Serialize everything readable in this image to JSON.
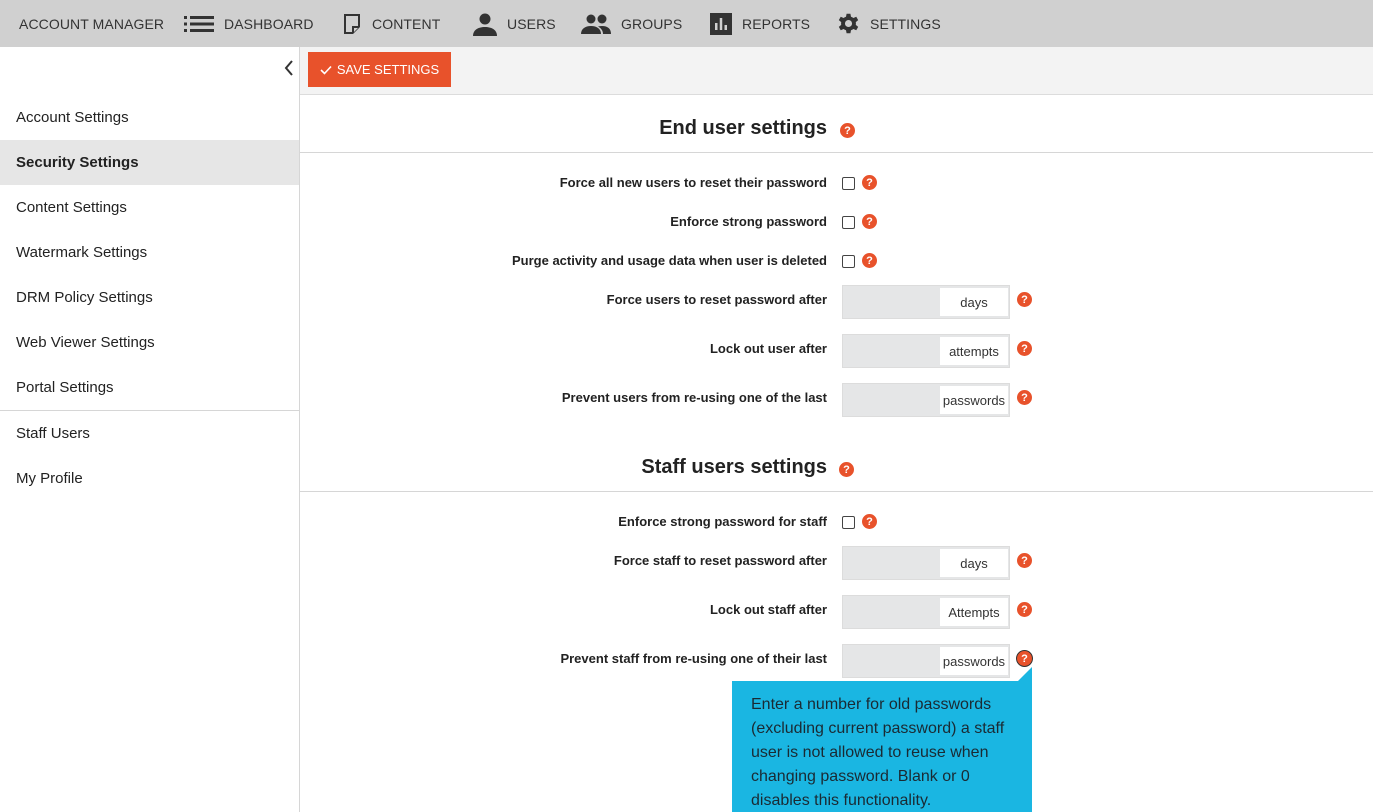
{
  "nav": {
    "brand": "ACCOUNT MANAGER",
    "items": [
      {
        "label": "DASHBOARD",
        "icon": "list-icon"
      },
      {
        "label": "CONTENT",
        "icon": "document-icon"
      },
      {
        "label": "USERS",
        "icon": "user-icon"
      },
      {
        "label": "GROUPS",
        "icon": "group-icon"
      },
      {
        "label": "REPORTS",
        "icon": "bar-chart-icon"
      },
      {
        "label": "SETTINGS",
        "icon": "gear-icon"
      }
    ]
  },
  "sidebar": {
    "items": [
      {
        "label": "Account Settings"
      },
      {
        "label": "Security Settings",
        "active": true
      },
      {
        "label": "Content Settings"
      },
      {
        "label": "Watermark Settings"
      },
      {
        "label": "DRM Policy Settings"
      },
      {
        "label": "Web Viewer Settings"
      },
      {
        "label": "Portal Settings"
      },
      {
        "label": "Staff Users"
      },
      {
        "label": "My Profile"
      }
    ]
  },
  "toolbar": {
    "save_label": "SAVE SETTINGS"
  },
  "end_user": {
    "title": "End user settings",
    "rows": [
      {
        "label": "Force all new users to reset their password",
        "type": "checkbox",
        "checked": false
      },
      {
        "label": "Enforce strong password",
        "type": "checkbox",
        "checked": false
      },
      {
        "label": "Purge activity and usage data when user is deleted",
        "type": "checkbox",
        "checked": false
      },
      {
        "label": "Force users to reset password after",
        "type": "number",
        "value": "",
        "unit": "days"
      },
      {
        "label": "Lock out user after",
        "type": "number",
        "value": "",
        "unit": "attempts"
      },
      {
        "label": "Prevent users from re-using one of the last",
        "type": "number",
        "value": "",
        "unit": "passwords"
      }
    ]
  },
  "staff": {
    "title": "Staff users settings",
    "rows": [
      {
        "label": "Enforce strong password for staff",
        "type": "checkbox",
        "checked": false
      },
      {
        "label": "Force staff to reset password after",
        "type": "number",
        "value": "",
        "unit": "days"
      },
      {
        "label": "Lock out staff after",
        "type": "number",
        "value": "",
        "unit": "Attempts"
      },
      {
        "label": "Prevent staff from re-using one of their last",
        "type": "number",
        "value": "",
        "unit": "passwords"
      }
    ]
  },
  "help_glyph": "?",
  "tooltip": {
    "text": "Enter a number for old passwords (excluding current password) a staff user is not allowed to reuse when changing password. Blank or 0 disables this functionality."
  },
  "colors": {
    "accent": "#e8522b",
    "tooltip": "#1ab6e2",
    "nav_bg": "#d0d0d0",
    "active_item": "#e6e6e6"
  }
}
